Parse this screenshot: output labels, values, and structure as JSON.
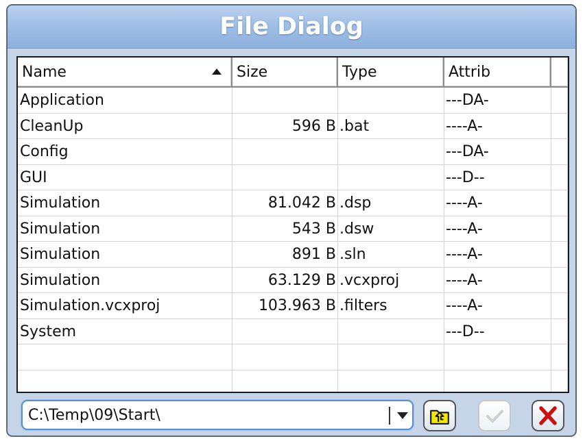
{
  "window": {
    "title": "File Dialog"
  },
  "list": {
    "columns": [
      "Name",
      "Size",
      "Type",
      "Attrib"
    ],
    "sorted_column": "Name",
    "sort_direction": "ascending",
    "rows": [
      {
        "name": "Application",
        "size": "",
        "type": "",
        "attrib": "---DA-"
      },
      {
        "name": "CleanUp",
        "size": "596 B",
        "type": ".bat",
        "attrib": "----A-"
      },
      {
        "name": "Config",
        "size": "",
        "type": "",
        "attrib": "---DA-"
      },
      {
        "name": "GUI",
        "size": "",
        "type": "",
        "attrib": "---D--"
      },
      {
        "name": "Simulation",
        "size": "81.042 B",
        "type": ".dsp",
        "attrib": "----A-"
      },
      {
        "name": "Simulation",
        "size": "543 B",
        "type": ".dsw",
        "attrib": "----A-"
      },
      {
        "name": "Simulation",
        "size": "891 B",
        "type": ".sln",
        "attrib": "----A-"
      },
      {
        "name": "Simulation",
        "size": "63.129 B",
        "type": ".vcxproj",
        "attrib": "----A-"
      },
      {
        "name": "Simulation.vcxproj",
        "size": "103.963 B",
        "type": ".filters",
        "attrib": "----A-"
      },
      {
        "name": "System",
        "size": "",
        "type": "",
        "attrib": "---D--"
      },
      {
        "name": "",
        "size": "",
        "type": "",
        "attrib": ""
      },
      {
        "name": "",
        "size": "",
        "type": "",
        "attrib": ""
      }
    ]
  },
  "path": {
    "value": "C:\\Temp\\09\\Start\\"
  },
  "buttons": {
    "up_icon": "folder-up-icon",
    "ok_icon": "checkmark-icon",
    "cancel_icon": "close-icon"
  },
  "colors": {
    "title_bar": "#9fbfe6",
    "frame": "#c5d4e6",
    "cancel": "#cc1010",
    "folder": "#f5e800"
  }
}
